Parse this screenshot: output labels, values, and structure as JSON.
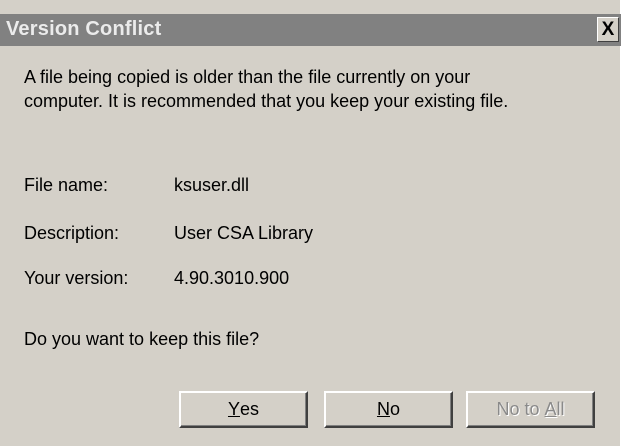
{
  "window": {
    "title": "Version Conflict",
    "close_glyph": "X"
  },
  "message": {
    "line1": "A file being copied is older than the file currently on your",
    "line2": "computer. It is recommended that you keep your existing file."
  },
  "file_info": {
    "name_label": "File name:",
    "name_value": "ksuser.dll",
    "description_label": "Description:",
    "description_value": "User CSA Library",
    "version_label": "Your version:",
    "version_value": "4.90.3010.900"
  },
  "question": "Do you want to keep this file?",
  "buttons": {
    "yes": {
      "accel": "Y",
      "rest": "es",
      "enabled": true
    },
    "no": {
      "accel": "N",
      "rest": "o",
      "enabled": true
    },
    "no_to_all": {
      "prefix": "No to ",
      "accel": "A",
      "rest": "ll",
      "enabled": false
    }
  },
  "colors": {
    "dialog_face": "#d4d0c8",
    "titlebar_inactive": "#818181",
    "title_text": "#ebebeb",
    "disabled_text": "#8a8a8a"
  },
  "icons": {
    "close": "close-icon"
  }
}
